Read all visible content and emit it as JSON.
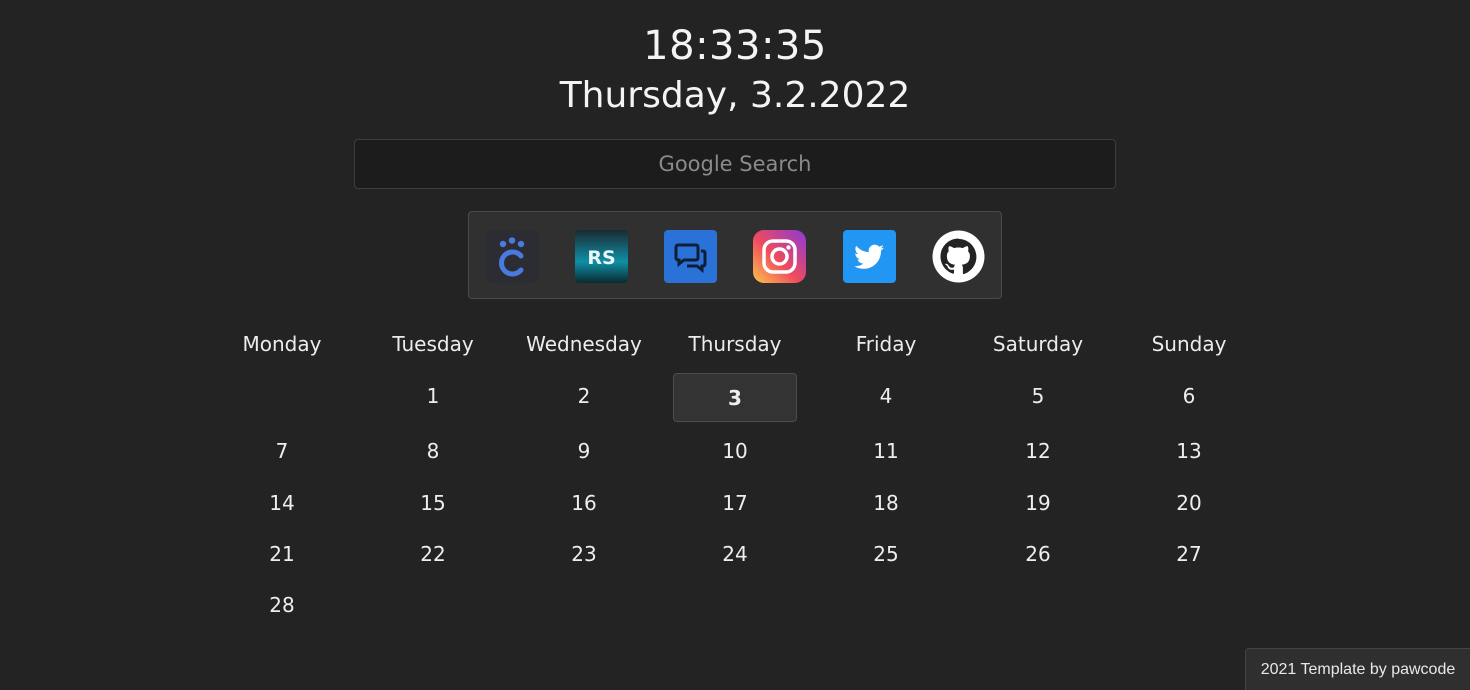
{
  "clock": {
    "time": "18:33:35",
    "date": "Thursday, 3.2.2022"
  },
  "search": {
    "placeholder": "Google Search",
    "value": ""
  },
  "links": [
    {
      "icon": "pawcode-icon",
      "colors": {
        "bg": "#2b2d33",
        "fg": "#4a7ae0"
      }
    },
    {
      "icon": "rs-icon",
      "text": "RS",
      "colors": {
        "bg_top": "#1a2a33",
        "bg_bottom": "#12c0d8"
      }
    },
    {
      "icon": "chat-icon",
      "colors": {
        "bg": "#2b72d8"
      }
    },
    {
      "icon": "instagram-icon",
      "colors": {
        "bg_from": "#f9a13a",
        "bg_to": "#b82ec9"
      }
    },
    {
      "icon": "twitter-icon",
      "colors": {
        "bg": "#2196f3"
      }
    },
    {
      "icon": "github-icon",
      "colors": {
        "fg": "#ffffff"
      }
    }
  ],
  "calendar": {
    "weekdays": [
      "Monday",
      "Tuesday",
      "Wednesday",
      "Thursday",
      "Friday",
      "Saturday",
      "Sunday"
    ],
    "weeks": [
      [
        "",
        "1",
        "2",
        "3",
        "4",
        "5",
        "6"
      ],
      [
        "7",
        "8",
        "9",
        "10",
        "11",
        "12",
        "13"
      ],
      [
        "14",
        "15",
        "16",
        "17",
        "18",
        "19",
        "20"
      ],
      [
        "21",
        "22",
        "23",
        "24",
        "25",
        "26",
        "27"
      ],
      [
        "28",
        "",
        "",
        "",
        "",
        "",
        ""
      ]
    ],
    "today": "3"
  },
  "footer": {
    "text": "2021 Template by pawcode"
  },
  "theme": {
    "background": "#232323",
    "panel": "#303030",
    "text": "#f2f2f2"
  }
}
